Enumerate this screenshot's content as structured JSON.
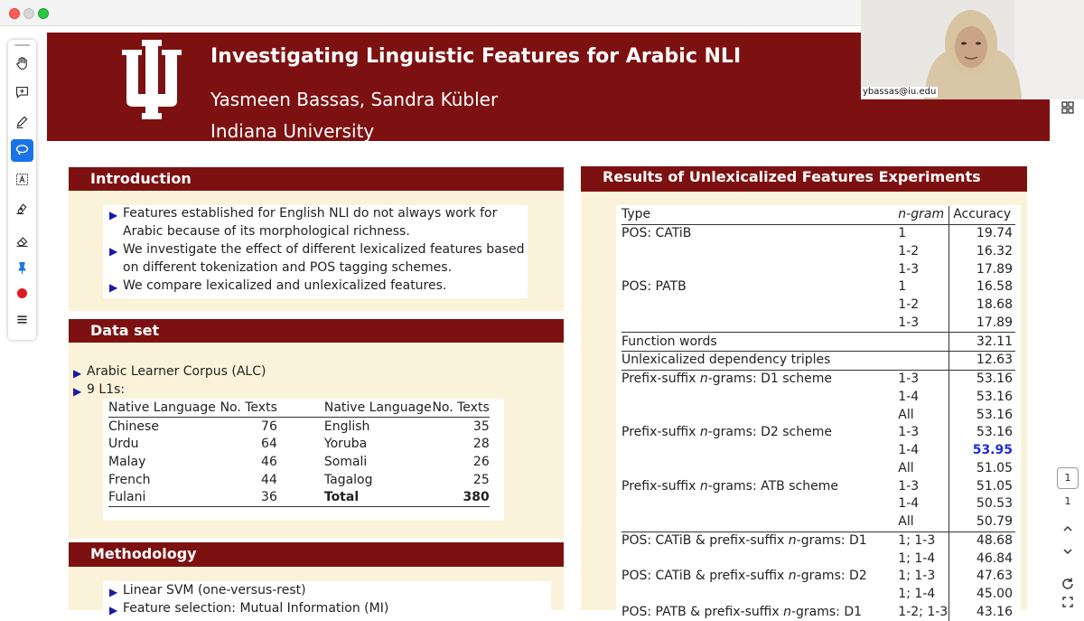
{
  "slide": {
    "title": "Investigating Linguistic Features for Arabic NLI",
    "authors": "Yasmeen Bassas, Sandra Kübler",
    "affiliation": "Indiana University"
  },
  "webcam": {
    "email": "ybassas@iu.edu"
  },
  "introduction": {
    "heading": "Introduction",
    "bullets": [
      "Features established for English NLI do not always work for Arabic because of its morphological richness.",
      "We investigate the effect of different lexicalized features based on different tokenization and POS tagging schemes.",
      "We compare lexicalized and unlexicalized features."
    ]
  },
  "dataset": {
    "heading": "Data set",
    "bullets": [
      "Arabic Learner Corpus (ALC)",
      "9 L1s:"
    ],
    "headers": [
      "Native Language",
      "No. Texts",
      "Native Language",
      "No. Texts"
    ],
    "rows": [
      [
        "Chinese",
        "76",
        "English",
        "35"
      ],
      [
        "Urdu",
        "64",
        "Yoruba",
        "28"
      ],
      [
        "Malay",
        "46",
        "Somali",
        "26"
      ],
      [
        "French",
        "44",
        "Tagalog",
        "25"
      ],
      [
        "Fulani",
        "36",
        "Total",
        "380"
      ]
    ]
  },
  "methodology": {
    "heading": "Methodology",
    "bullets": [
      "Linear SVM (one-versus-rest)",
      "Feature selection: Mutual Information (MI)"
    ]
  },
  "results": {
    "heading": "Results of Unlexicalized Features Experiments",
    "headers": [
      "Type",
      "n-gram",
      "Accuracy"
    ],
    "rows": [
      [
        "POS: CATiB",
        "1",
        "19.74"
      ],
      [
        "",
        "1-2",
        "16.32"
      ],
      [
        "",
        "1-3",
        "17.89"
      ],
      [
        "POS: PATB",
        "1",
        "16.58"
      ],
      [
        "",
        "1-2",
        "18.68"
      ],
      [
        "",
        "1-3",
        "17.89"
      ],
      [
        "Function words",
        "",
        "32.11"
      ],
      [
        "Unlexicalized dependency triples",
        "",
        "12.63"
      ],
      [
        "Prefix-suffix n-grams: D1 scheme",
        "1-3",
        "53.16"
      ],
      [
        "",
        "1-4",
        "53.16"
      ],
      [
        "",
        "All",
        "53.16"
      ],
      [
        "Prefix-suffix n-grams: D2 scheme",
        "1-3",
        "53.16"
      ],
      [
        "",
        "1-4",
        "53.95"
      ],
      [
        "",
        "All",
        "51.05"
      ],
      [
        "Prefix-suffix n-grams: ATB scheme",
        "1-3",
        "51.05"
      ],
      [
        "",
        "1-4",
        "50.53"
      ],
      [
        "",
        "All",
        "50.79"
      ],
      [
        "POS: CATiB & prefix-suffix n-grams: D1",
        "1; 1-3",
        "48.68"
      ],
      [
        "",
        "1; 1-4",
        "46.84"
      ],
      [
        "POS: CATiB & prefix-suffix n-grams: D2",
        "1; 1-3",
        "47.63"
      ],
      [
        "",
        "1; 1-4",
        "45.00"
      ],
      [
        "POS: PATB & prefix-suffix n-grams: D1",
        "1-2; 1-3",
        "43.16"
      ]
    ],
    "highlight_value": "53.95",
    "highlight_color": "#1f2fcf"
  },
  "toolbar": {
    "tools": [
      "hand-icon",
      "add-comment-icon",
      "pen-icon",
      "lasso-icon",
      "text-box-icon",
      "highlighter-icon",
      "eraser-icon",
      "pin-icon",
      "record-icon",
      "menu-icon"
    ]
  },
  "pager": {
    "current_page": "1",
    "total_pages": "1"
  },
  "colors": {
    "banner": "#7d1111",
    "panel_body": "#fbf3d9",
    "bullet": "#1a1aa6",
    "active_tool": "#1a73e8"
  }
}
